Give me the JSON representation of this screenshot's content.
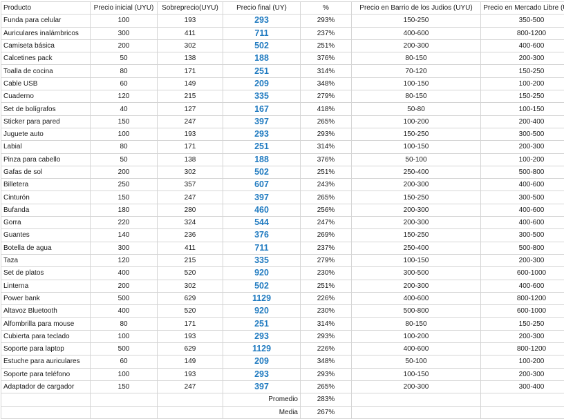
{
  "headers": [
    "Producto",
    "Precio inicial (UYU)",
    "Sobreprecio(UYU)",
    "Precio final (UY)",
    "%",
    "Precio en Barrio de los Judios (UYU)",
    "Precio en Mercado Libre (UYU)"
  ],
  "rows": [
    [
      "Funda para celular",
      "100",
      "193",
      "293",
      "293%",
      "150-250",
      "350-500"
    ],
    [
      "Auriculares inalámbricos",
      "300",
      "411",
      "711",
      "237%",
      "400-600",
      "800-1200"
    ],
    [
      "Camiseta básica",
      "200",
      "302",
      "502",
      "251%",
      "200-300",
      "400-600"
    ],
    [
      "Calcetines pack",
      "50",
      "138",
      "188",
      "376%",
      "80-150",
      "200-300"
    ],
    [
      "Toalla de cocina",
      "80",
      "171",
      "251",
      "314%",
      "70-120",
      "150-250"
    ],
    [
      "Cable USB",
      "60",
      "149",
      "209",
      "348%",
      "100-150",
      "100-200"
    ],
    [
      "Cuaderno",
      "120",
      "215",
      "335",
      "279%",
      "80-150",
      "150-250"
    ],
    [
      "Set de bolígrafos",
      "40",
      "127",
      "167",
      "418%",
      "50-80",
      "100-150"
    ],
    [
      "Sticker para pared",
      "150",
      "247",
      "397",
      "265%",
      "100-200",
      "200-400"
    ],
    [
      "Juguete auto",
      "100",
      "193",
      "293",
      "293%",
      "150-250",
      "300-500"
    ],
    [
      "Labial",
      "80",
      "171",
      "251",
      "314%",
      "100-150",
      "200-300"
    ],
    [
      "Pinza para cabello",
      "50",
      "138",
      "188",
      "376%",
      "50-100",
      "100-200"
    ],
    [
      "Gafas de sol",
      "200",
      "302",
      "502",
      "251%",
      "250-400",
      "500-800"
    ],
    [
      "Billetera",
      "250",
      "357",
      "607",
      "243%",
      "200-300",
      "400-600"
    ],
    [
      "Cinturón",
      "150",
      "247",
      "397",
      "265%",
      "150-250",
      "300-500"
    ],
    [
      "Bufanda",
      "180",
      "280",
      "460",
      "256%",
      "200-300",
      "400-600"
    ],
    [
      "Gorra",
      "220",
      "324",
      "544",
      "247%",
      "200-300",
      "400-600"
    ],
    [
      "Guantes",
      "140",
      "236",
      "376",
      "269%",
      "150-250",
      "300-500"
    ],
    [
      "Botella de agua",
      "300",
      "411",
      "711",
      "237%",
      "250-400",
      "500-800"
    ],
    [
      "Taza",
      "120",
      "215",
      "335",
      "279%",
      "100-150",
      "200-300"
    ],
    [
      "Set de platos",
      "400",
      "520",
      "920",
      "230%",
      "300-500",
      "600-1000"
    ],
    [
      "Linterna",
      "200",
      "302",
      "502",
      "251%",
      "200-300",
      "400-600"
    ],
    [
      "Power bank",
      "500",
      "629",
      "1129",
      "226%",
      "400-600",
      "800-1200"
    ],
    [
      "Altavoz Bluetooth",
      "400",
      "520",
      "920",
      "230%",
      "500-800",
      "600-1000"
    ],
    [
      "Alfombrilla para mouse",
      "80",
      "171",
      "251",
      "314%",
      "80-150",
      "150-250"
    ],
    [
      "Cubierta para teclado",
      "100",
      "193",
      "293",
      "293%",
      "100-200",
      "200-300"
    ],
    [
      "Soporte para laptop",
      "500",
      "629",
      "1129",
      "226%",
      "400-600",
      "800-1200"
    ],
    [
      "Estuche para auriculares",
      "60",
      "149",
      "209",
      "348%",
      "50-100",
      "100-200"
    ],
    [
      "Soporte para teléfono",
      "100",
      "193",
      "293",
      "293%",
      "100-150",
      "200-300"
    ],
    [
      "Adaptador de cargador",
      "150",
      "247",
      "397",
      "265%",
      "200-300",
      "300-400"
    ]
  ],
  "stats": [
    {
      "label": "Promedio",
      "value": "283%"
    },
    {
      "label": "Media",
      "value": "267%"
    }
  ],
  "colors": {
    "final_price": "#1f7ac0",
    "grid": "#d4d4d4",
    "text": "#1a1a1a"
  }
}
